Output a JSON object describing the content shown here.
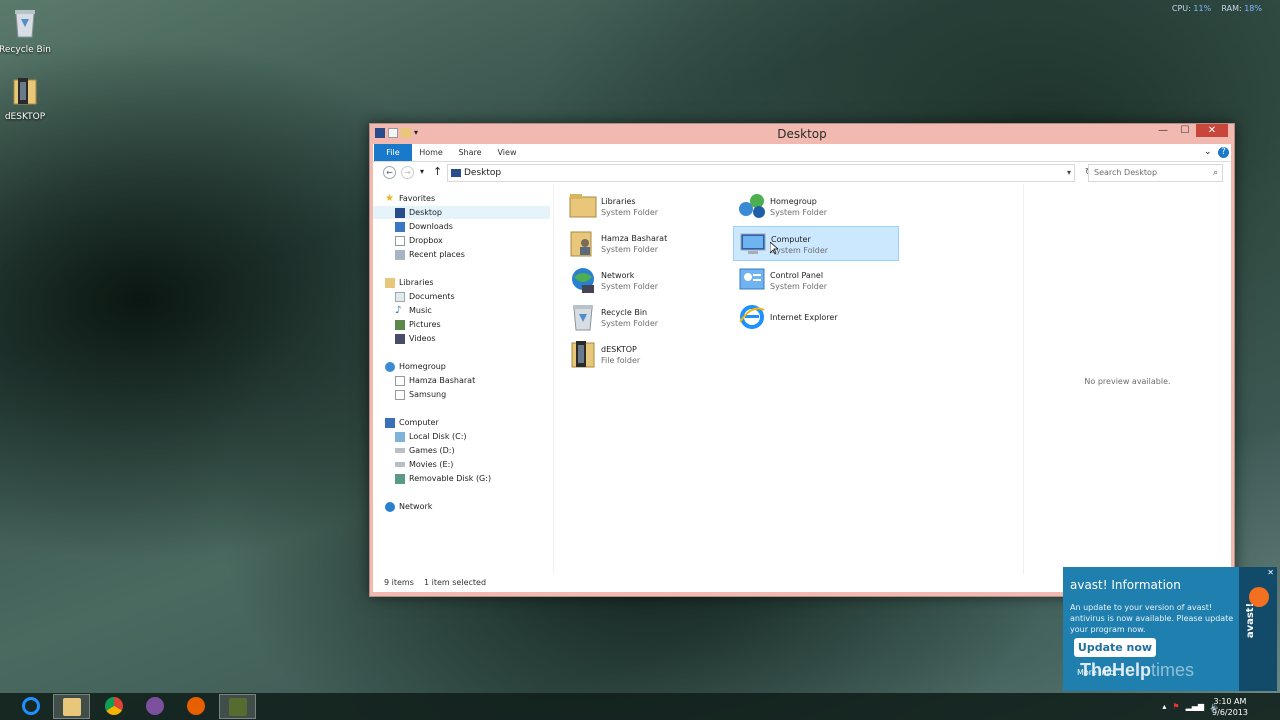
{
  "desktop": {
    "icons": [
      {
        "label": "Recycle Bin",
        "icon": "recycle-bin-icon"
      },
      {
        "label": "dESKTOP",
        "icon": "folder-icon"
      }
    ],
    "cpu_label": "CPU:",
    "cpu_value": "11%",
    "ram_label": "RAM:",
    "ram_value": "18%"
  },
  "window": {
    "title": "Desktop",
    "ribbon_tabs": [
      "File",
      "Home",
      "Share",
      "View"
    ],
    "address": "Desktop",
    "search_placeholder": "Search Desktop",
    "nav": [
      {
        "label": "Favorites",
        "icon": "star-icon"
      },
      {
        "label": "Desktop",
        "icon": "desktop-icon",
        "selected": true
      },
      {
        "label": "Downloads",
        "icon": "download-icon"
      },
      {
        "label": "Dropbox",
        "icon": "dropbox-icon"
      },
      {
        "label": "Recent places",
        "icon": "recent-places-icon"
      },
      {
        "label": "Libraries",
        "icon": "library-icon"
      },
      {
        "label": "Documents",
        "icon": "document-icon"
      },
      {
        "label": "Music",
        "icon": "music-icon"
      },
      {
        "label": "Pictures",
        "icon": "picture-icon"
      },
      {
        "label": "Videos",
        "icon": "video-icon"
      },
      {
        "label": "Homegroup",
        "icon": "homegroup-icon"
      },
      {
        "label": "Hamza Basharat",
        "icon": "user-icon"
      },
      {
        "label": "Samsung",
        "icon": "user-icon"
      },
      {
        "label": "Computer",
        "icon": "computer-icon"
      },
      {
        "label": "Local Disk (C:)",
        "icon": "drive-icon"
      },
      {
        "label": "Games (D:)",
        "icon": "drive-icon"
      },
      {
        "label": "Movies (E:)",
        "icon": "drive-icon"
      },
      {
        "label": "Removable Disk (G:)",
        "icon": "usb-drive-icon"
      },
      {
        "label": "Network",
        "icon": "network-icon"
      }
    ],
    "files": [
      {
        "name": "Libraries",
        "type": "System Folder",
        "icon": "libraries-icon"
      },
      {
        "name": "Homegroup",
        "type": "System Folder",
        "icon": "homegroup-icon"
      },
      {
        "name": "Hamza Basharat",
        "type": "System Folder",
        "icon": "user-folder-icon"
      },
      {
        "name": "Computer",
        "type": "System Folder",
        "icon": "computer-icon",
        "selected": true
      },
      {
        "name": "Network",
        "type": "System Folder",
        "icon": "network-icon"
      },
      {
        "name": "Control Panel",
        "type": "System Folder",
        "icon": "control-panel-icon"
      },
      {
        "name": "Recycle Bin",
        "type": "System Folder",
        "icon": "recycle-bin-icon"
      },
      {
        "name": "Internet Explorer",
        "type": "",
        "icon": "internet-explorer-icon"
      },
      {
        "name": "dESKTOP",
        "type": "File folder",
        "icon": "folder-icon"
      }
    ],
    "preview_text": "No preview available.",
    "status_count": "9 items",
    "status_selected": "1 item selected"
  },
  "avast": {
    "title": "avast! Information",
    "message": "An update to your version of avast! antivirus is now available. Please update your program now.",
    "button": "Update now",
    "logo": "avast!",
    "more": "More info…"
  },
  "watermark": {
    "bold": "TheHelp",
    "light": "times"
  },
  "taskbar": {
    "apps": [
      "internet-explorer-icon",
      "file-explorer-icon",
      "chrome-icon",
      "viber-icon",
      "firefox-icon",
      "app-icon"
    ],
    "time": "3:10 AM",
    "date": "9/6/2013"
  },
  "colors": {
    "accent": "#1979ca",
    "window_frame": "#f1b9b0",
    "selection": "#cce8ff",
    "avast": "#1f7fae"
  }
}
